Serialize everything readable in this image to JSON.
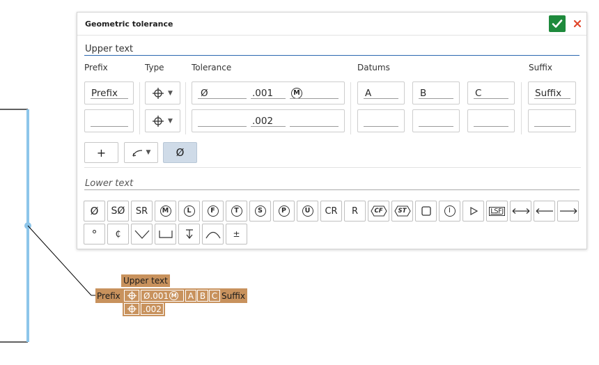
{
  "dialog": {
    "title": "Geometric tolerance",
    "upper_section": "Upper text",
    "lower_section": "Lower text",
    "columns": {
      "prefix": "Prefix",
      "type": "Type",
      "tolerance": "Tolerance",
      "datums": "Datums",
      "suffix": "Suffix"
    },
    "row1": {
      "prefix": "Prefix",
      "type_symbol": "position-icon",
      "diameter": "Ø",
      "tolerance": ".001",
      "modifier": "M",
      "datums": [
        "A",
        "B",
        "C"
      ],
      "suffix": "Suffix"
    },
    "row2": {
      "prefix": "",
      "type_symbol": "position-icon",
      "diameter": "",
      "tolerance": ".002",
      "modifier": "",
      "datums": [
        "",
        "",
        ""
      ],
      "suffix": ""
    },
    "toolbar": {
      "add_label": "+",
      "diameter_label": "Ø"
    },
    "symbols_row1": [
      "Ø",
      "SØ",
      "SR",
      "M",
      "L",
      "F",
      "T",
      "S",
      "P",
      "U",
      "CR",
      "R",
      "CF",
      "ST",
      "square-icon",
      "I",
      "triangle-icon",
      "LSFJ",
      "arrow-both-icon",
      "arrow-left-icon",
      "arrow-right-icon"
    ],
    "symbols_row2": [
      "°",
      "₵",
      "countersink-icon",
      "counterbore-icon",
      "depth-icon",
      "arc-icon",
      "±"
    ]
  },
  "annotation": {
    "upper_text": "Upper text",
    "prefix": "Prefix",
    "row1": {
      "tolerance": "Ø.001",
      "modifier": "M",
      "datums": [
        "A",
        "B",
        "C"
      ]
    },
    "suffix": "Suffix",
    "row2": {
      "tolerance": ".002"
    }
  },
  "colors": {
    "accent": "#2a67b0",
    "ok": "#1e8a3c",
    "close": "#e0462a",
    "annotation": "#c8925d",
    "line": "#8ec6ea"
  }
}
